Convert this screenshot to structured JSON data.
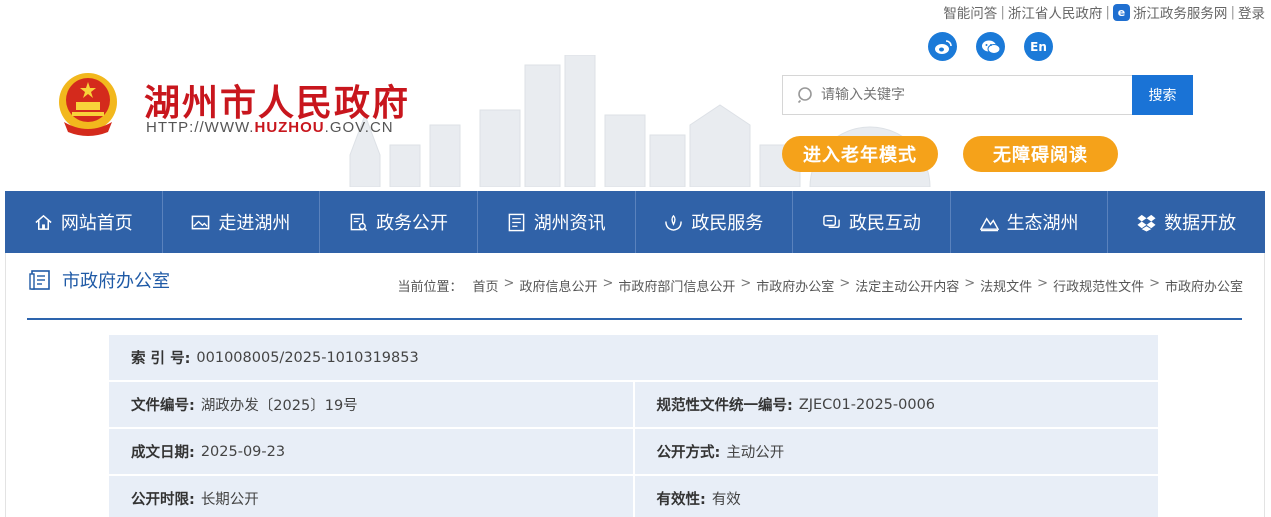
{
  "top_links": {
    "qa": "智能问答",
    "provincial_gov": "浙江省人民政府",
    "zj_service": "浙江政务服务网",
    "login": "登录",
    "separator": "|"
  },
  "social": {
    "weibo": "weibo-icon",
    "wechat": "wechat-icon",
    "english": "En"
  },
  "header": {
    "title": "湖州市人民政府",
    "url_prefix": "HTTP://WWW.",
    "url_highlight": "HUZHOU",
    "url_suffix": ".GOV.CN"
  },
  "search": {
    "placeholder": "请输入关键字",
    "button": "搜索"
  },
  "modes": {
    "elder": "进入老年模式",
    "accessible": "无障碍阅读"
  },
  "nav": [
    {
      "label": "网站首页",
      "icon": "home-icon"
    },
    {
      "label": "走进湖州",
      "icon": "picture-icon"
    },
    {
      "label": "政务公开",
      "icon": "document-search-icon"
    },
    {
      "label": "湖州资讯",
      "icon": "news-icon"
    },
    {
      "label": "政民服务",
      "icon": "hands-icon"
    },
    {
      "label": "政民互动",
      "icon": "chat-icon"
    },
    {
      "label": "生态湖州",
      "icon": "mountain-icon"
    },
    {
      "label": "数据开放",
      "icon": "dropbox-icon"
    }
  ],
  "column": {
    "title": "市政府办公室"
  },
  "breadcrumb": {
    "label": "当前位置：",
    "items": [
      "首页",
      "政府信息公开",
      "市政府部门信息公开",
      "市政府办公室",
      "法定主动公开内容",
      "法规文件",
      "行政规范性文件",
      "市政府办公室"
    ],
    "sep": ">"
  },
  "info": {
    "index_key": "索 引 号:",
    "index_val": "001008005/2025-1010319853",
    "docno_key": "文件编号:",
    "docno_val": "湖政办发〔2025〕19号",
    "unified_key": "规范性文件统一编号:",
    "unified_val": "ZJEC01-2025-0006",
    "date_key": "成文日期:",
    "date_val": "2025-09-23",
    "mode_key": "公开方式:",
    "mode_val": "主动公开",
    "term_key": "公开时限:",
    "term_val": "长期公开",
    "valid_key": "有效性:",
    "valid_val": "有效"
  },
  "colors": {
    "brand_red": "#c8161d",
    "nav_blue": "#3062a8",
    "accent_orange": "#f5a21a",
    "search_blue": "#1a73d6"
  }
}
